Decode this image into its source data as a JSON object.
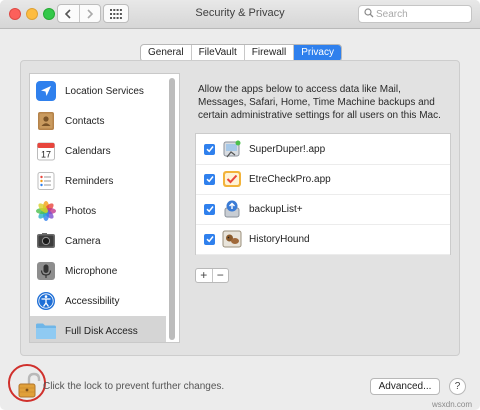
{
  "window": {
    "title": "Security & Privacy"
  },
  "search": {
    "placeholder": "Search"
  },
  "tabs": [
    {
      "label": "General"
    },
    {
      "label": "FileVault"
    },
    {
      "label": "Firewall"
    },
    {
      "label": "Privacy"
    }
  ],
  "active_tab": "Privacy",
  "sidebar": {
    "items": [
      {
        "label": "Location Services",
        "icon": "location-arrow-icon"
      },
      {
        "label": "Contacts",
        "icon": "contacts-book-icon"
      },
      {
        "label": "Calendars",
        "icon": "calendar-icon"
      },
      {
        "label": "Reminders",
        "icon": "reminders-list-icon"
      },
      {
        "label": "Photos",
        "icon": "photos-flower-icon"
      },
      {
        "label": "Camera",
        "icon": "camera-icon"
      },
      {
        "label": "Microphone",
        "icon": "microphone-icon"
      },
      {
        "label": "Accessibility",
        "icon": "accessibility-icon"
      },
      {
        "label": "Full Disk Access",
        "icon": "folder-icon"
      }
    ],
    "selected": "Full Disk Access"
  },
  "calendar_day": "17",
  "description": "Allow the apps below to access data like Mail, Messages, Safari, Home, Time Machine backups and certain administrative settings for all users on this Mac.",
  "apps": [
    {
      "name": "SuperDuper!.app",
      "checked": true,
      "icon": "superduper-app-icon"
    },
    {
      "name": "EtreCheckPro.app",
      "checked": true,
      "icon": "etrecheck-app-icon"
    },
    {
      "name": "backupList+",
      "checked": true,
      "icon": "backuplist-app-icon"
    },
    {
      "name": "HistoryHound",
      "checked": true,
      "icon": "historyhound-app-icon"
    }
  ],
  "list_controls": {
    "add": "+",
    "remove": "−"
  },
  "footer": {
    "lock_text": "Click the lock to prevent further changes.",
    "advanced_label": "Advanced...",
    "help_label": "?"
  },
  "watermark": "wsxdn.com",
  "colors": {
    "accent": "#2f80ed",
    "lock_highlight": "#d0302c"
  }
}
